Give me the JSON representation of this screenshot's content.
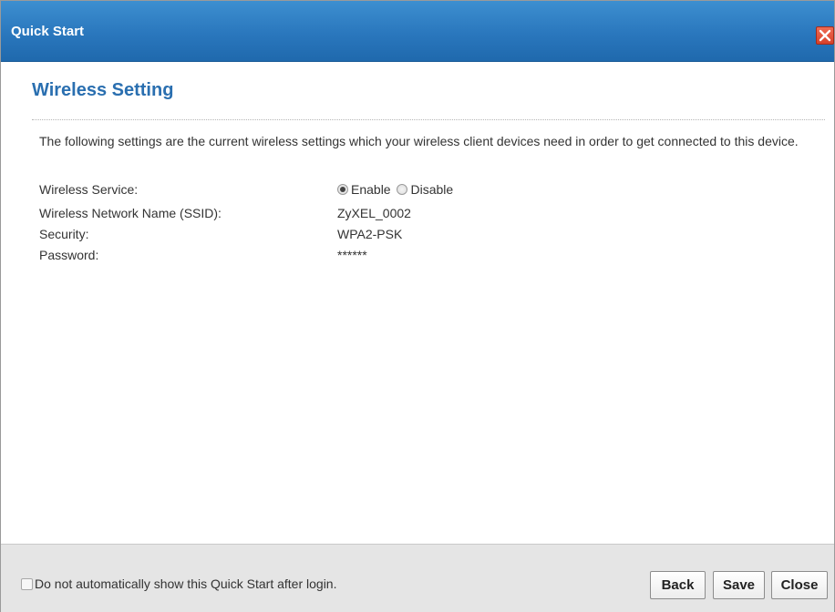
{
  "window": {
    "title": "Quick Start",
    "close_icon": "close-icon"
  },
  "main": {
    "heading": "Wireless Setting",
    "intro": "The following settings are the current wireless settings which your wireless client devices need in order to get connected to this device.",
    "fields": {
      "service_label": "Wireless Service:",
      "service_options": [
        "Enable",
        "Disable"
      ],
      "service_selected": "Enable",
      "ssid_label": "Wireless Network Name (SSID):",
      "ssid_value": "ZyXEL_0002",
      "security_label": "Security:",
      "security_value": "WPA2-PSK",
      "password_label": "Password:",
      "password_value": "******"
    }
  },
  "footer": {
    "checkbox_label": "Do not automatically show this Quick Start after login.",
    "checkbox_checked": false,
    "back_label": "Back",
    "save_label": "Save",
    "close_label": "Close"
  },
  "colors": {
    "titlebar": "#2a77bd",
    "heading": "#2a6fb0",
    "close_button": "#d8412a",
    "footer_bg": "#e5e5e5"
  }
}
